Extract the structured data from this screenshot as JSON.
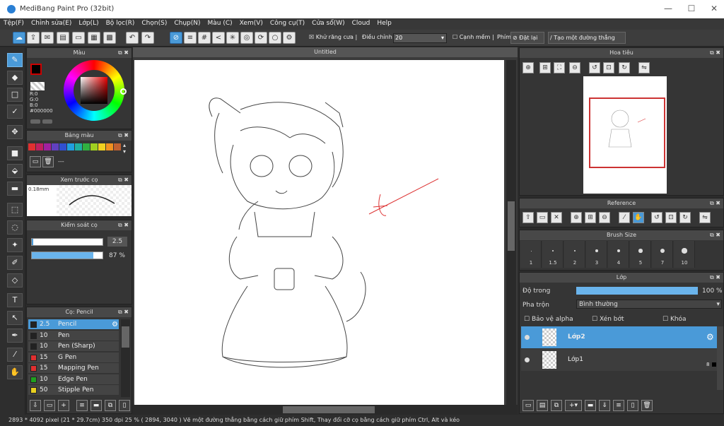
{
  "window": {
    "title": "MediBang Paint Pro (32bit)",
    "minimize": "—",
    "maximize": "☐",
    "close": "✕"
  },
  "menu": [
    "Tệp(F)",
    "Chỉnh sửa(E)",
    "Lớp(L)",
    "Bộ lọc(R)",
    "Chọn(S)",
    "Chụp(N)",
    "Màu (C)",
    "Xem(V)",
    "Công cụ(T)",
    "Cửa sổ(W)",
    "Cloud",
    "Help"
  ],
  "toolbar": {
    "antialias": "Khử răng cưa",
    "adjust_label": "Điều chỉnh",
    "adjust_value": "20",
    "smooth": "Cạnh mềm",
    "key_label": "Phím",
    "reset": "Đặt lại",
    "straight_line": "Tạo một đường thẳng"
  },
  "panels": {
    "color": "Màu",
    "palette": "Bảng màu",
    "preview": "Xem trước cọ",
    "brush_control": "Kiểm soát cọ",
    "brushes": "Cọ: Pencil",
    "navigator": "Hoa tiêu",
    "reference": "Reference",
    "brush_size": "Brush Size",
    "layers": "Lớp"
  },
  "color": {
    "r": "R:0",
    "g": "G:0",
    "b": "B:0",
    "hex": "#000000",
    "palette_dash": "---"
  },
  "palette_colors": [
    "#e03030",
    "#c02060",
    "#a020a0",
    "#6040c0",
    "#3050d0",
    "#20a0e0",
    "#20b0a0",
    "#30b040",
    "#a0d020",
    "#f0d020",
    "#f09020",
    "#c06030"
  ],
  "preview": {
    "size": "0.18mm"
  },
  "brush_control": {
    "size": "2.5",
    "opacity": "87 %",
    "opacity_fill": 0.87
  },
  "brushes": [
    {
      "size": "2.5",
      "name": "Pencil",
      "color": "#222222",
      "selected": true
    },
    {
      "size": "10",
      "name": "Pen",
      "color": "#222222"
    },
    {
      "size": "10",
      "name": "Pen (Sharp)",
      "color": "#222222"
    },
    {
      "size": "15",
      "name": "G Pen",
      "color": "#e03030"
    },
    {
      "size": "15",
      "name": "Mapping Pen",
      "color": "#e03030"
    },
    {
      "size": "10",
      "name": "Edge Pen",
      "color": "#20a020"
    },
    {
      "size": "50",
      "name": "Stipple Pen",
      "color": "#e8d020"
    }
  ],
  "canvas": {
    "title": "Untitled"
  },
  "brush_sizes": [
    "1",
    "1.5",
    "2",
    "3",
    "4",
    "5",
    "7",
    "10"
  ],
  "layers": {
    "opacity_label": "Độ trong",
    "opacity_value": "100 %",
    "blend_label": "Pha trộn",
    "blend_value": "Bình thường",
    "protect_alpha": "Bảo vệ alpha",
    "clip": "Xén bớt",
    "lock": "Khóa",
    "items": [
      {
        "name": "Lớp2",
        "selected": true,
        "badge": ""
      },
      {
        "name": "Lớp1",
        "selected": false,
        "badge": "8"
      }
    ]
  },
  "status": "2893 * 4092 pixel   (21 * 29.7cm)  350 dpi  25 %  ( 2894, 3040 )  Vẽ một đường thẳng bằng cách giữ phím Shift, Thay đổi cỡ cọ bằng cách giữ phím Ctrl, Alt và kéo"
}
